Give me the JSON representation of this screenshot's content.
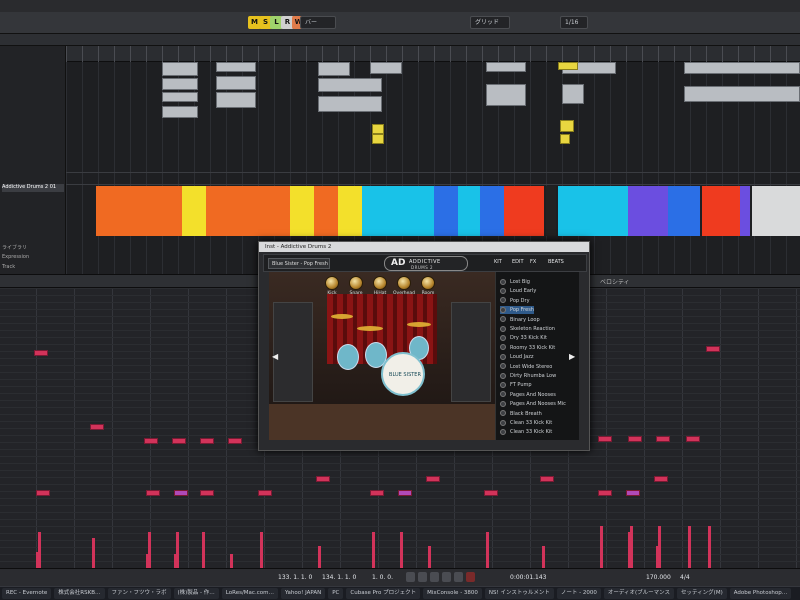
{
  "plugin": {
    "title": "Inst - Addictive Drums 2",
    "kit_name": "Blue Sister - Pop Fresh *",
    "logo_line1": "ADDICTIVE",
    "logo_line2": "DRUMS 2",
    "tabs": [
      "KIT",
      "EDIT",
      "FX",
      "BEATS"
    ],
    "knobs": [
      "Kick",
      "Snare",
      "HiHat",
      "Overhead",
      "Room"
    ],
    "kick_head_text": "BLUE SISTER",
    "presets": [
      "Lost Big",
      "Loud Early",
      "Pop Dry",
      "Pop Fresh",
      "Binary Loop",
      "Skeleton Reaction",
      "Dry 33 Kick Kit",
      "Roomy 33 Kick Kit",
      "Loud Jazz",
      "Lost Wide Stereo",
      "Dirty Rhumba Low",
      "FT Pump",
      "Pages And Nooses",
      "Pages And Nooses Mic",
      "Black Breath",
      "Clean 33 Kick Kit",
      "Clean 33 Kick Kit"
    ],
    "selected_preset_index": 3
  },
  "toolbar": {
    "buttons": [
      "M",
      "S",
      "L",
      "R",
      "W",
      "A"
    ],
    "button_colors": [
      "#e6c11e",
      "#e6c11e",
      "#9fd26b",
      "#cfcfcf",
      "#e07b4a",
      "#cfcfcf"
    ],
    "snap_label": "グリッド",
    "quantize_label": "1/16",
    "bar_label": "バー"
  },
  "inspector": {
    "track_name": "Addictive Drums 2 01",
    "labels": [
      "ライブラリ",
      "Expression",
      "Track"
    ]
  },
  "keyeditor": {
    "header": "ベロシティ"
  },
  "transport": {
    "left_locator": "133. 1. 1. 0",
    "right_locator": "134. 1. 1. 0",
    "position": "1. 0. 0.",
    "time": "0:00:01.143",
    "tempo": "170.000",
    "signature": "4/4"
  },
  "taskbar": {
    "items": [
      "REC - Evernote",
      "株式会社RSKB…",
      "ファン・フツウ・ラボ",
      "(株)製品 - 作…",
      "LoRes/Mac.com…",
      "Yahoo! JAPAN",
      "PC",
      "Cubase Pro プロジェクト",
      "MixConsole - 3800",
      "NS! インストゥルメント",
      "ノート - 2000",
      "オーディオ(ブルーマンス",
      "セッティング(M)",
      "Adobe Photoshop…"
    ]
  },
  "colors": {
    "red_block": "#ef3b1f",
    "orange_block": "#f06a22",
    "yellow_block": "#f3e02b",
    "cyan_block": "#19c2e8",
    "blue_block": "#2b6fe6",
    "purple_block": "#6b4ee0",
    "note_color": "#d2335a",
    "note_alt": "#b04ab8"
  }
}
